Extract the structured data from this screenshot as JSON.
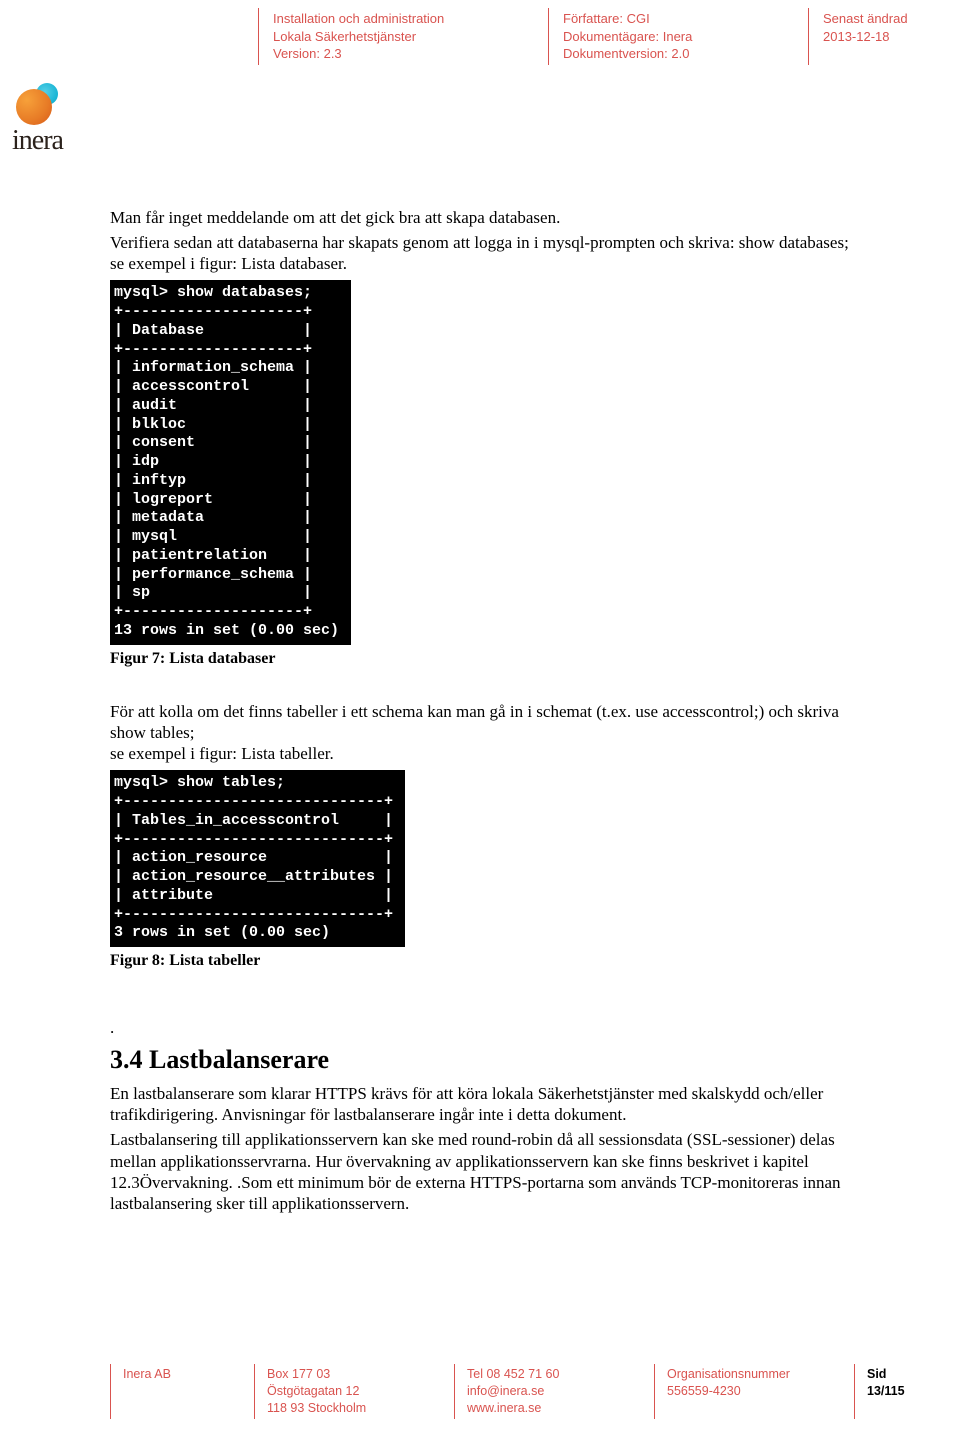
{
  "header": {
    "col1": {
      "line1": "Installation och administration",
      "line2": "Lokala Säkerhetstjänster",
      "line3": "Version: 2.3"
    },
    "col2": {
      "line1": "Författare: CGI",
      "line2": "Dokumentägare: Inera",
      "line3": "Dokumentversion: 2.0"
    },
    "col3": {
      "line1": "Senast ändrad",
      "line2": "2013-12-18"
    }
  },
  "logo_text": "inera",
  "body": {
    "p1": "Man får inget meddelande om att det gick bra att skapa databasen.",
    "p2": "Verifiera sedan att databaserna har skapats genom att logga in i mysql-prompten och skriva: show databases; se exempel i figur: Lista databaser.",
    "terminal1": "mysql> show databases;\n+--------------------+\n| Database           |\n+--------------------+\n| information_schema |\n| accesscontrol      |\n| audit              |\n| blkloc             |\n| consent            |\n| idp                |\n| inftyp             |\n| logreport          |\n| metadata           |\n| mysql              |\n| patientrelation    |\n| performance_schema |\n| sp                 |\n+--------------------+\n13 rows in set (0.00 sec)",
    "fig7": "Figur 7: Lista databaser",
    "p3": "För att kolla om det finns tabeller i ett schema kan man gå in i schemat (t.ex. use accesscontrol;) och skriva show tables;\nse exempel i figur: Lista tabeller.",
    "terminal2": "mysql> show tables;\n+-----------------------------+\n| Tables_in_accesscontrol     |\n+-----------------------------+\n| action_resource             |\n| action_resource__attributes |\n| attribute                   |\n+-----------------------------+\n3 rows in set (0.00 sec)",
    "fig8": "Figur 8: Lista tabeller",
    "dot": ".",
    "heading": "3.4  Lastbalanserare",
    "p4": "En lastbalanserare som klarar HTTPS krävs för att köra lokala Säkerhetstjänster med skalskydd och/eller trafikdirigering. Anvisningar för lastbalanserare ingår inte i detta dokument.",
    "p5": "Lastbalansering till applikationsservern kan ske med round-robin då all sessionsdata (SSL-sessioner) delas mellan applikationsservrarna. Hur övervakning av applikationsservern kan ske finns beskrivet i kapitel 12.3Övervakning. .Som ett minimum bör de externa HTTPS-portarna som används TCP-monitoreras innan lastbalansering sker till applikationsservern."
  },
  "footer": {
    "c1": {
      "l1": "Inera AB"
    },
    "c2": {
      "l1": "Box 177 03",
      "l2": "Östgötagatan 12",
      "l3": "118 93 Stockholm"
    },
    "c3": {
      "l1": "Tel 08 452 71 60",
      "l2": "info@inera.se",
      "l3": "www.inera.se"
    },
    "c4": {
      "l1": "Organisationsnummer",
      "l2": "556559-4230"
    },
    "c5": {
      "l1": "Sid 13/115"
    }
  }
}
